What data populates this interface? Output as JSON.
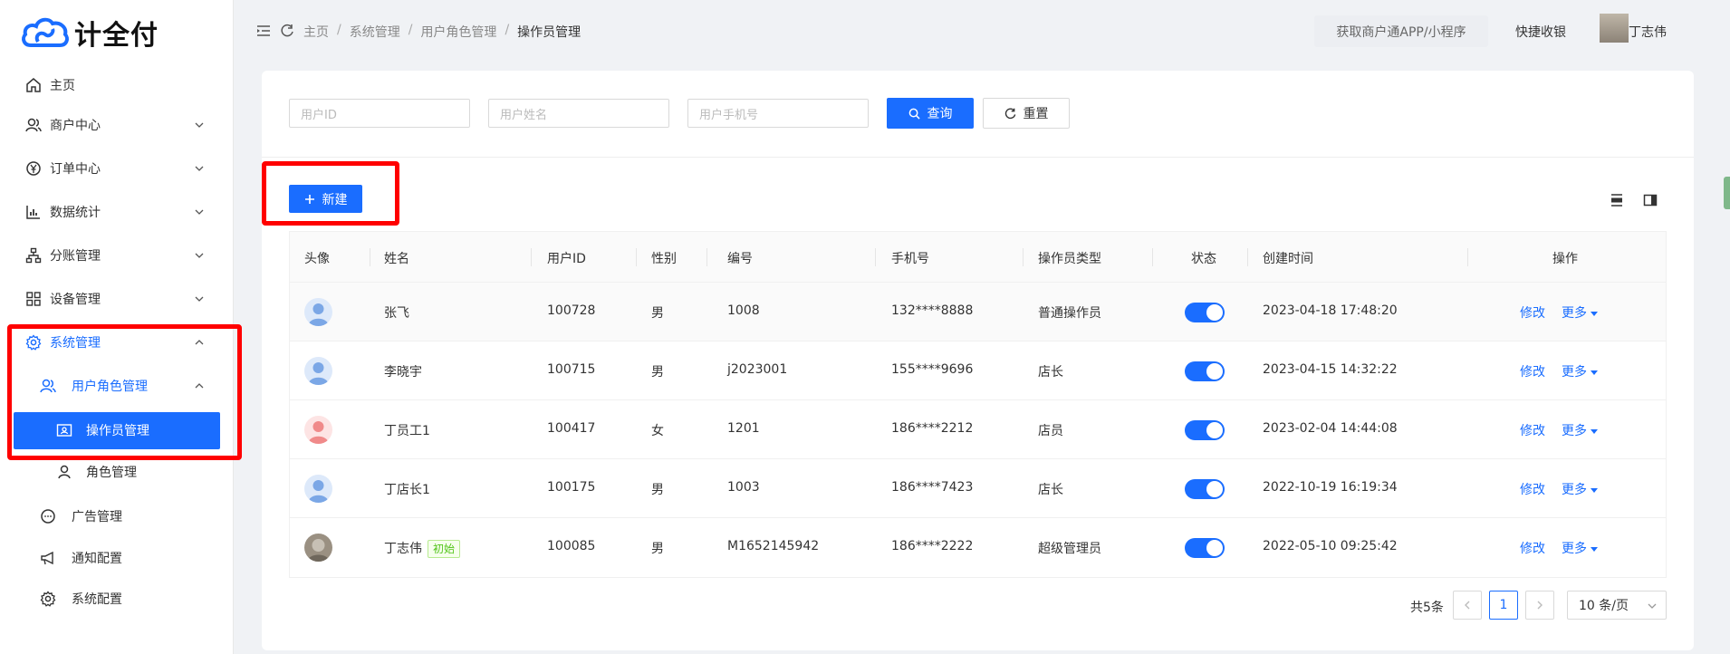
{
  "brand": {
    "name": "计全付"
  },
  "sidebar": {
    "items": [
      {
        "label": "主页"
      },
      {
        "label": "商户中心"
      },
      {
        "label": "订单中心"
      },
      {
        "label": "数据统计"
      },
      {
        "label": "分账管理"
      },
      {
        "label": "设备管理"
      },
      {
        "label": "系统管理"
      },
      {
        "label": "用户角色管理"
      },
      {
        "label": "操作员管理"
      },
      {
        "label": "角色管理"
      },
      {
        "label": "广告管理"
      },
      {
        "label": "通知配置"
      },
      {
        "label": "系统配置"
      }
    ]
  },
  "header": {
    "breadcrumb": [
      "主页",
      "系统管理",
      "用户角色管理",
      "操作员管理"
    ],
    "app_button": "获取商户通APP/小程序",
    "quick_pay": "快捷收银",
    "username": "丁志伟"
  },
  "search": {
    "user_id_placeholder": "用户ID",
    "user_name_placeholder": "用户姓名",
    "user_phone_placeholder": "用户手机号",
    "query_label": "查询",
    "reset_label": "重置"
  },
  "toolbar": {
    "new_label": "新建"
  },
  "table": {
    "headers": [
      "头像",
      "姓名",
      "用户ID",
      "性别",
      "编号",
      "手机号",
      "操作员类型",
      "状态",
      "创建时间",
      "操作"
    ],
    "rows": [
      {
        "name": "张飞",
        "tag": "",
        "user_id": "100728",
        "gender": "男",
        "code": "1008",
        "phone": "132****8888",
        "type": "普通操作员",
        "status_on": true,
        "created": "2023-04-18 17:48:20",
        "avatar": "blue"
      },
      {
        "name": "李晓宇",
        "tag": "",
        "user_id": "100715",
        "gender": "男",
        "code": "j2023001",
        "phone": "155****9696",
        "type": "店长",
        "status_on": true,
        "created": "2023-04-15 14:32:22",
        "avatar": "blue"
      },
      {
        "name": "丁员工1",
        "tag": "",
        "user_id": "100417",
        "gender": "女",
        "code": "1201",
        "phone": "186****2212",
        "type": "店员",
        "status_on": true,
        "created": "2023-02-04 14:44:08",
        "avatar": "pink"
      },
      {
        "name": "丁店长1",
        "tag": "",
        "user_id": "100175",
        "gender": "男",
        "code": "1003",
        "phone": "186****7423",
        "type": "店长",
        "status_on": true,
        "created": "2022-10-19 16:19:34",
        "avatar": "blue"
      },
      {
        "name": "丁志伟",
        "tag": "初始",
        "user_id": "100085",
        "gender": "男",
        "code": "M1652145942",
        "phone": "186****2222",
        "type": "超级管理员",
        "status_on": true,
        "created": "2022-05-10 09:25:42",
        "avatar": "photo"
      }
    ],
    "edit_label": "修改",
    "more_label": "更多"
  },
  "pagination": {
    "total": "共5条",
    "current_page": "1",
    "page_size": "10 条/页"
  },
  "colors": {
    "primary": "#1a6dff",
    "highlight": "#ff0000"
  }
}
